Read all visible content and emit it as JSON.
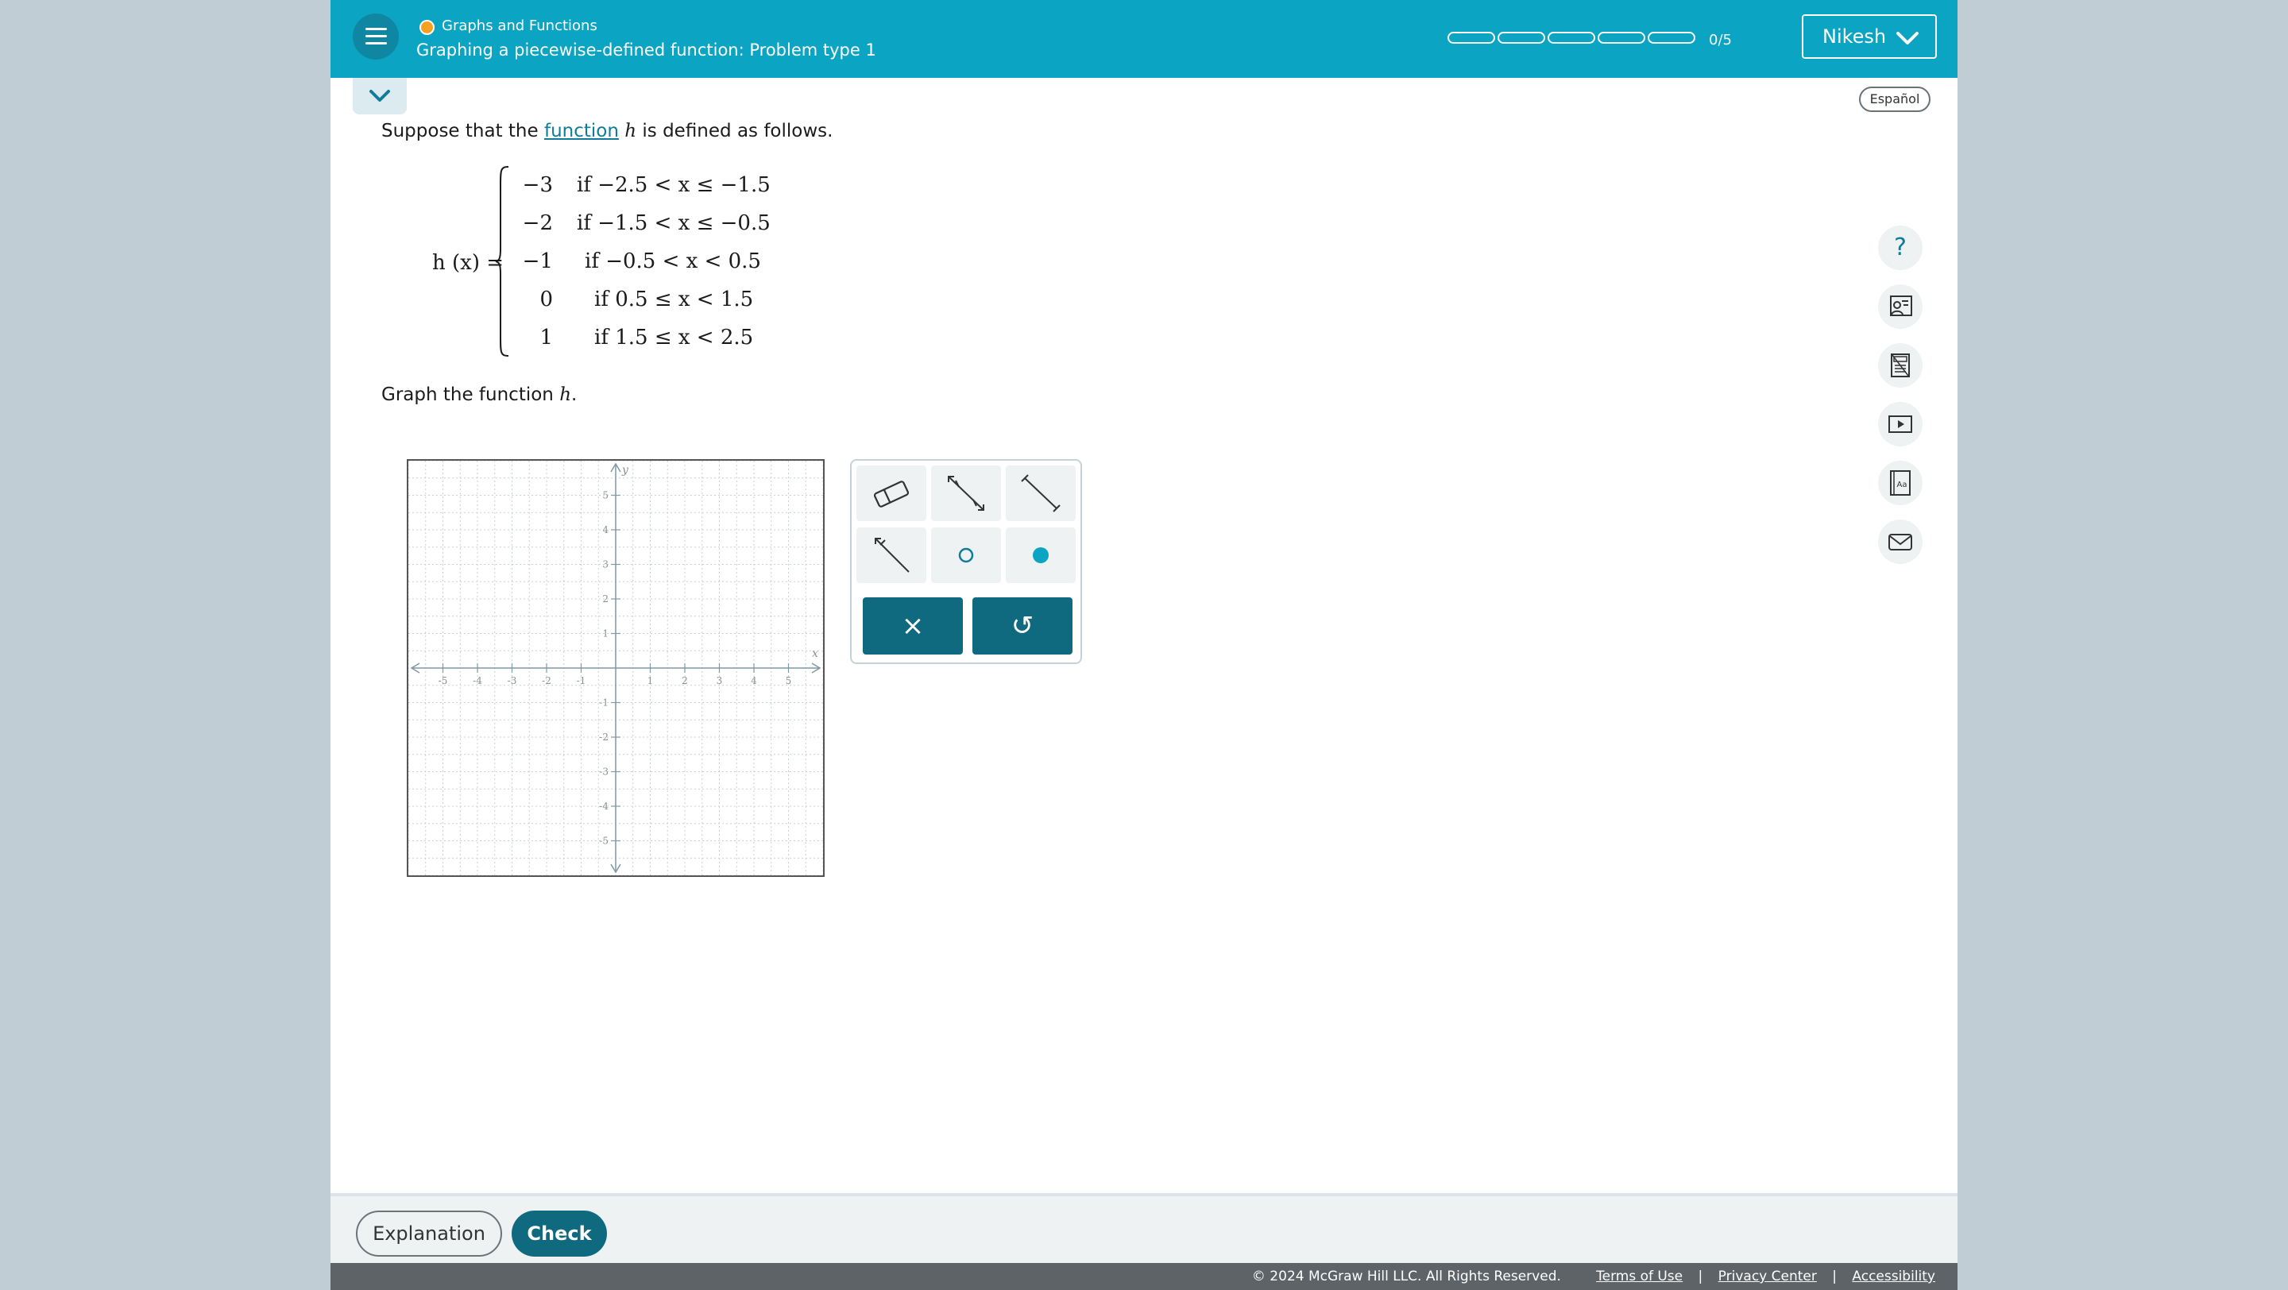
{
  "header": {
    "topic": "Graphs and Functions",
    "title": "Graphing a piecewise-defined function: Problem type 1",
    "progress_count": "0/5",
    "progress_segments": 5,
    "progress_completed": 0,
    "user_name": "Nikesh",
    "topic_dot_color": "#f6a020"
  },
  "language_button": "Español",
  "problem": {
    "prompt_before": "Suppose that the ",
    "prompt_link": "function",
    "prompt_var": "h",
    "prompt_after": " is defined as follows.",
    "function_lhs": "h (x) =",
    "pieces": [
      {
        "value": "−3",
        "condition": "if −2.5 < x ≤ −1.5"
      },
      {
        "value": "−2",
        "condition": "if −1.5 < x ≤ −0.5"
      },
      {
        "value": "−1",
        "condition": "if −0.5 < x < 0.5"
      },
      {
        "value": "0",
        "condition": "if 0.5 ≤ x < 1.5"
      },
      {
        "value": "1",
        "condition": "if 1.5 ≤ x < 2.5"
      }
    ],
    "graph_prompt_before": "Graph the function ",
    "graph_prompt_var": "h",
    "graph_prompt_after": "."
  },
  "graph": {
    "x_label": "x",
    "y_label": "y",
    "x_ticks": [
      "-5",
      "-4",
      "-3",
      "-2",
      "-1",
      "1",
      "2",
      "3",
      "4",
      "5"
    ],
    "y_ticks": [
      "5",
      "4",
      "3",
      "2",
      "1",
      "-1",
      "-2",
      "-3",
      "-4",
      "-5"
    ],
    "xlim": [
      -6,
      6
    ],
    "ylim": [
      -6,
      6
    ],
    "grid": true
  },
  "tools": [
    {
      "name": "eraser-tool-icon"
    },
    {
      "name": "line-tool-icon"
    },
    {
      "name": "segment-tool-icon"
    },
    {
      "name": "ray-tool-icon"
    },
    {
      "name": "open-point-tool-icon"
    },
    {
      "name": "closed-point-tool-icon"
    }
  ],
  "tool_actions": {
    "clear": "×",
    "undo": "↺"
  },
  "side_tools": [
    "help-icon",
    "tutor-icon",
    "calculator-icon",
    "video-icon",
    "dictionary-icon",
    "message-icon"
  ],
  "side_help_glyph": "?",
  "bottom": {
    "explanation_label": "Explanation",
    "check_label": "Check"
  },
  "footer": {
    "copyright": "© 2024 McGraw Hill LLC. All Rights Reserved.",
    "terms": "Terms of Use",
    "privacy": "Privacy Center",
    "accessibility": "Accessibility",
    "separator": "|"
  },
  "colors": {
    "header": "#0ba4c3",
    "accent": "#0f6a80",
    "link": "#0f7d99"
  }
}
